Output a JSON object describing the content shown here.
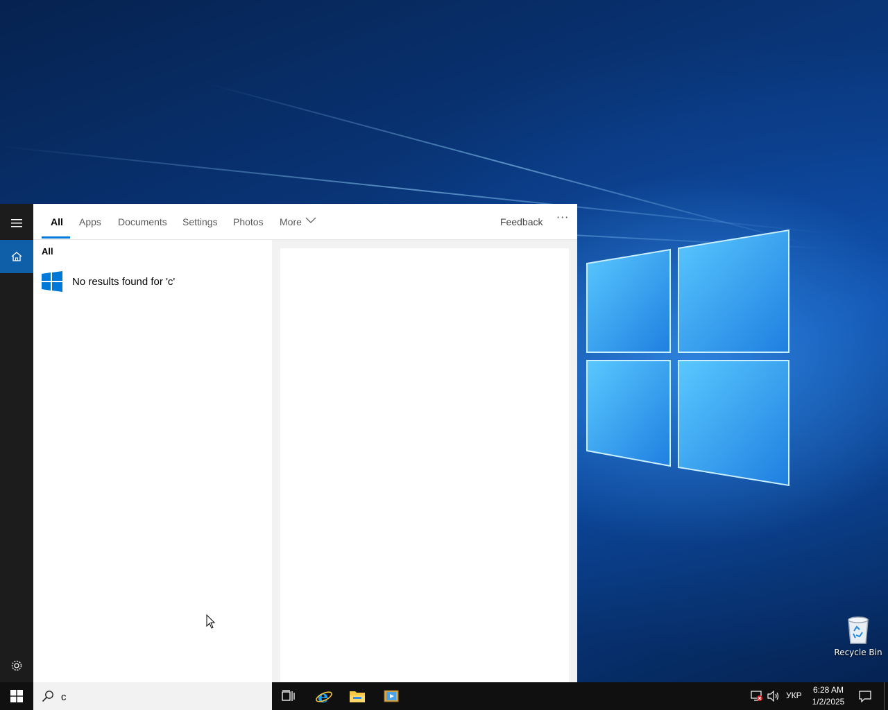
{
  "desktop": {
    "icons": [
      {
        "label": "Recycle Bin",
        "icon": "recycle-bin-icon"
      }
    ]
  },
  "start_rail": {
    "items": [
      "hamburger-menu-icon",
      "home-icon",
      "settings-gear-icon"
    ]
  },
  "search_panel": {
    "tabs": [
      {
        "label": "All",
        "active": true
      },
      {
        "label": "Apps"
      },
      {
        "label": "Documents"
      },
      {
        "label": "Settings"
      },
      {
        "label": "Photos"
      },
      {
        "label": "More"
      }
    ],
    "feedback_label": "Feedback",
    "overflow_label": "···",
    "results_heading": "All",
    "no_results_text": "No results found for 'c'"
  },
  "taskbar": {
    "search_value": "c",
    "pinned": [
      "task-view-icon",
      "internet-explorer-icon",
      "file-explorer-icon",
      "media-player-icon"
    ],
    "tray": {
      "language": "УКР",
      "time": "6:28 AM",
      "date": "1/2/2025"
    }
  },
  "colors": {
    "accent": "#0078d7",
    "rail_bg": "#1c1c1c",
    "taskbar_bg": "#101010",
    "home_active_bg": "#0f5fa8"
  }
}
